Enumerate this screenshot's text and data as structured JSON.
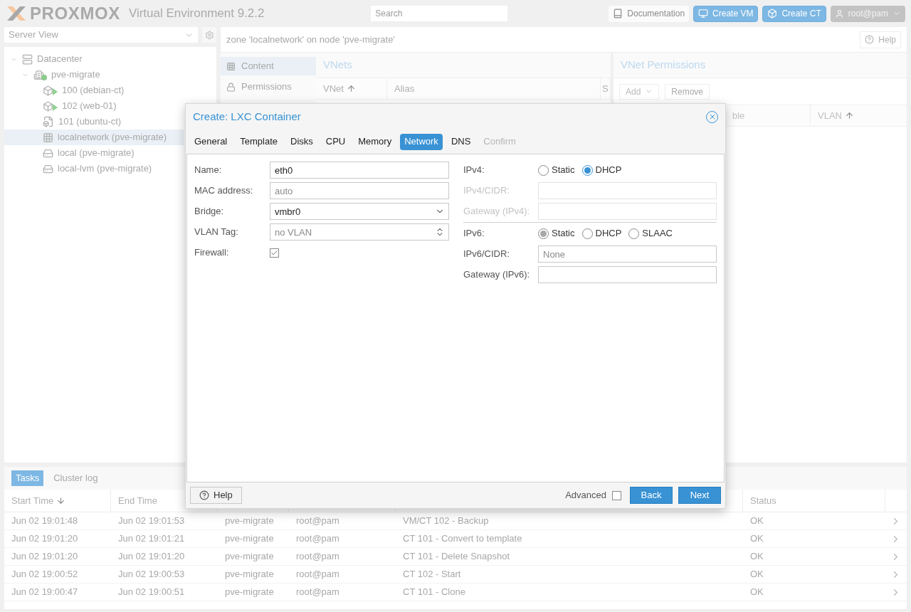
{
  "header": {
    "logo": "PROXMOX",
    "product": "Virtual Environment 9.2.2",
    "search": {
      "placeholder": "Search"
    },
    "buttons": [
      {
        "label": "Documentation",
        "kind": "docs"
      },
      {
        "label": "Create VM",
        "kind": "vm"
      },
      {
        "label": "Create CT",
        "kind": "ct"
      }
    ],
    "user": "root@pam"
  },
  "sidebar": {
    "view": "Server View",
    "tree": [
      {
        "label": "Datacenter",
        "kind": "datacenter",
        "selected": false,
        "expanded": true,
        "children": [
          {
            "label": "pve-migrate",
            "kind": "node",
            "selected": false,
            "expanded": true,
            "children": [
              {
                "label": "100 (debian-ct)",
                "kind": "container-running",
                "selected": false
              },
              {
                "label": "102 (web-01)",
                "kind": "container-running",
                "selected": false
              },
              {
                "label": "101 (ubuntu-ct)",
                "kind": "template",
                "selected": false
              },
              {
                "label": "localnetwork (pve-migrate)",
                "kind": "zone",
                "selected": true
              },
              {
                "label": "local (pve-migrate)",
                "kind": "storage",
                "selected": false
              },
              {
                "label": "local-lvm (pve-migrate)",
                "kind": "storage",
                "selected": false
              }
            ]
          }
        ]
      }
    ]
  },
  "main": {
    "title": "zone 'localnetwork' on node 'pve-migrate'",
    "help": "Help",
    "side_tabs": [
      {
        "label": "Content",
        "kind": "grid",
        "selected": true
      },
      {
        "label": "Permissions",
        "kind": "lock",
        "selected": false
      }
    ],
    "vnets": {
      "title": "VNets",
      "columns": [
        {
          "label": "VNet",
          "sorted": true
        },
        {
          "label": "Alias",
          "sorted": false
        },
        {
          "label": "S",
          "sorted": false
        }
      ]
    },
    "permissions": {
      "title": "VNet Permissions",
      "add": "Add",
      "remove": "Remove",
      "columns": [
        {
          "label": "ble",
          "sorted": false
        },
        {
          "label": "VLAN",
          "sorted": true
        }
      ]
    }
  },
  "tasks": {
    "tabs": [
      {
        "label": "Tasks",
        "selected": true
      },
      {
        "label": "Cluster log",
        "selected": false
      }
    ],
    "columns_left": [
      {
        "label": "Start Time",
        "sorted": true
      },
      {
        "label": "End Time",
        "sorted": false
      }
    ],
    "columns_right": [
      {
        "label": "Status",
        "sorted": false
      }
    ],
    "rows": [
      [
        "Jun 02 19:01:48",
        "Jun 02 19:01:53",
        "pve-migrate",
        "root@pam",
        "VM/CT 102 - Backup",
        "OK"
      ],
      [
        "Jun 02 19:01:20",
        "Jun 02 19:01:21",
        "pve-migrate",
        "root@pam",
        "CT 101 - Convert to template",
        "OK"
      ],
      [
        "Jun 02 19:01:20",
        "Jun 02 19:01:20",
        "pve-migrate",
        "root@pam",
        "CT 101 - Delete Snapshot",
        "OK"
      ],
      [
        "Jun 02 19:00:52",
        "Jun 02 19:00:53",
        "pve-migrate",
        "root@pam",
        "CT 102 - Start",
        "OK"
      ],
      [
        "Jun 02 19:00:47",
        "Jun 02 19:00:51",
        "pve-migrate",
        "root@pam",
        "CT 101 - Clone",
        "OK"
      ]
    ]
  },
  "dialog": {
    "title": "Create: LXC Container",
    "tabs": [
      {
        "label": "General",
        "selected": false,
        "disabled": false
      },
      {
        "label": "Template",
        "selected": false,
        "disabled": false
      },
      {
        "label": "Disks",
        "selected": false,
        "disabled": false
      },
      {
        "label": "CPU",
        "selected": false,
        "disabled": false
      },
      {
        "label": "Memory",
        "selected": false,
        "disabled": false
      },
      {
        "label": "Network",
        "selected": true,
        "disabled": false
      },
      {
        "label": "DNS",
        "selected": false,
        "disabled": false
      },
      {
        "label": "Confirm",
        "selected": false,
        "disabled": true
      }
    ],
    "left": [
      {
        "label": "Name:",
        "kind": "text",
        "value": "eth0"
      },
      {
        "label": "MAC address:",
        "kind": "text",
        "placeholder": "auto"
      },
      {
        "label": "Bridge:",
        "kind": "combo",
        "value": "vmbr0"
      },
      {
        "label": "VLAN Tag:",
        "kind": "spinner",
        "placeholder": "no VLAN"
      },
      {
        "label": "Firewall:",
        "kind": "checkbox",
        "checked": true
      }
    ],
    "right": [
      {
        "label": "IPv4:",
        "kind": "radio",
        "focused": true,
        "options": [
          {
            "label": "Static",
            "selected": false
          },
          {
            "label": "DHCP",
            "selected": true
          }
        ]
      },
      {
        "label": "IPv4/CIDR:",
        "kind": "text",
        "disabled": true
      },
      {
        "label": "Gateway (IPv4):",
        "kind": "text",
        "disabled": true
      },
      {
        "label": "IPv6:",
        "kind": "radio",
        "focused": false,
        "options": [
          {
            "label": "Static",
            "selected": true
          },
          {
            "label": "DHCP",
            "selected": false
          },
          {
            "label": "SLAAC",
            "selected": false
          }
        ]
      },
      {
        "label": "IPv6/CIDR:",
        "kind": "text",
        "disabled": false,
        "placeholder": "None"
      },
      {
        "label": "Gateway (IPv6):",
        "kind": "text",
        "disabled": false
      }
    ],
    "help": "Help",
    "advanced": {
      "label": "Advanced",
      "checked": false
    },
    "back": "Back",
    "next": "Next"
  }
}
